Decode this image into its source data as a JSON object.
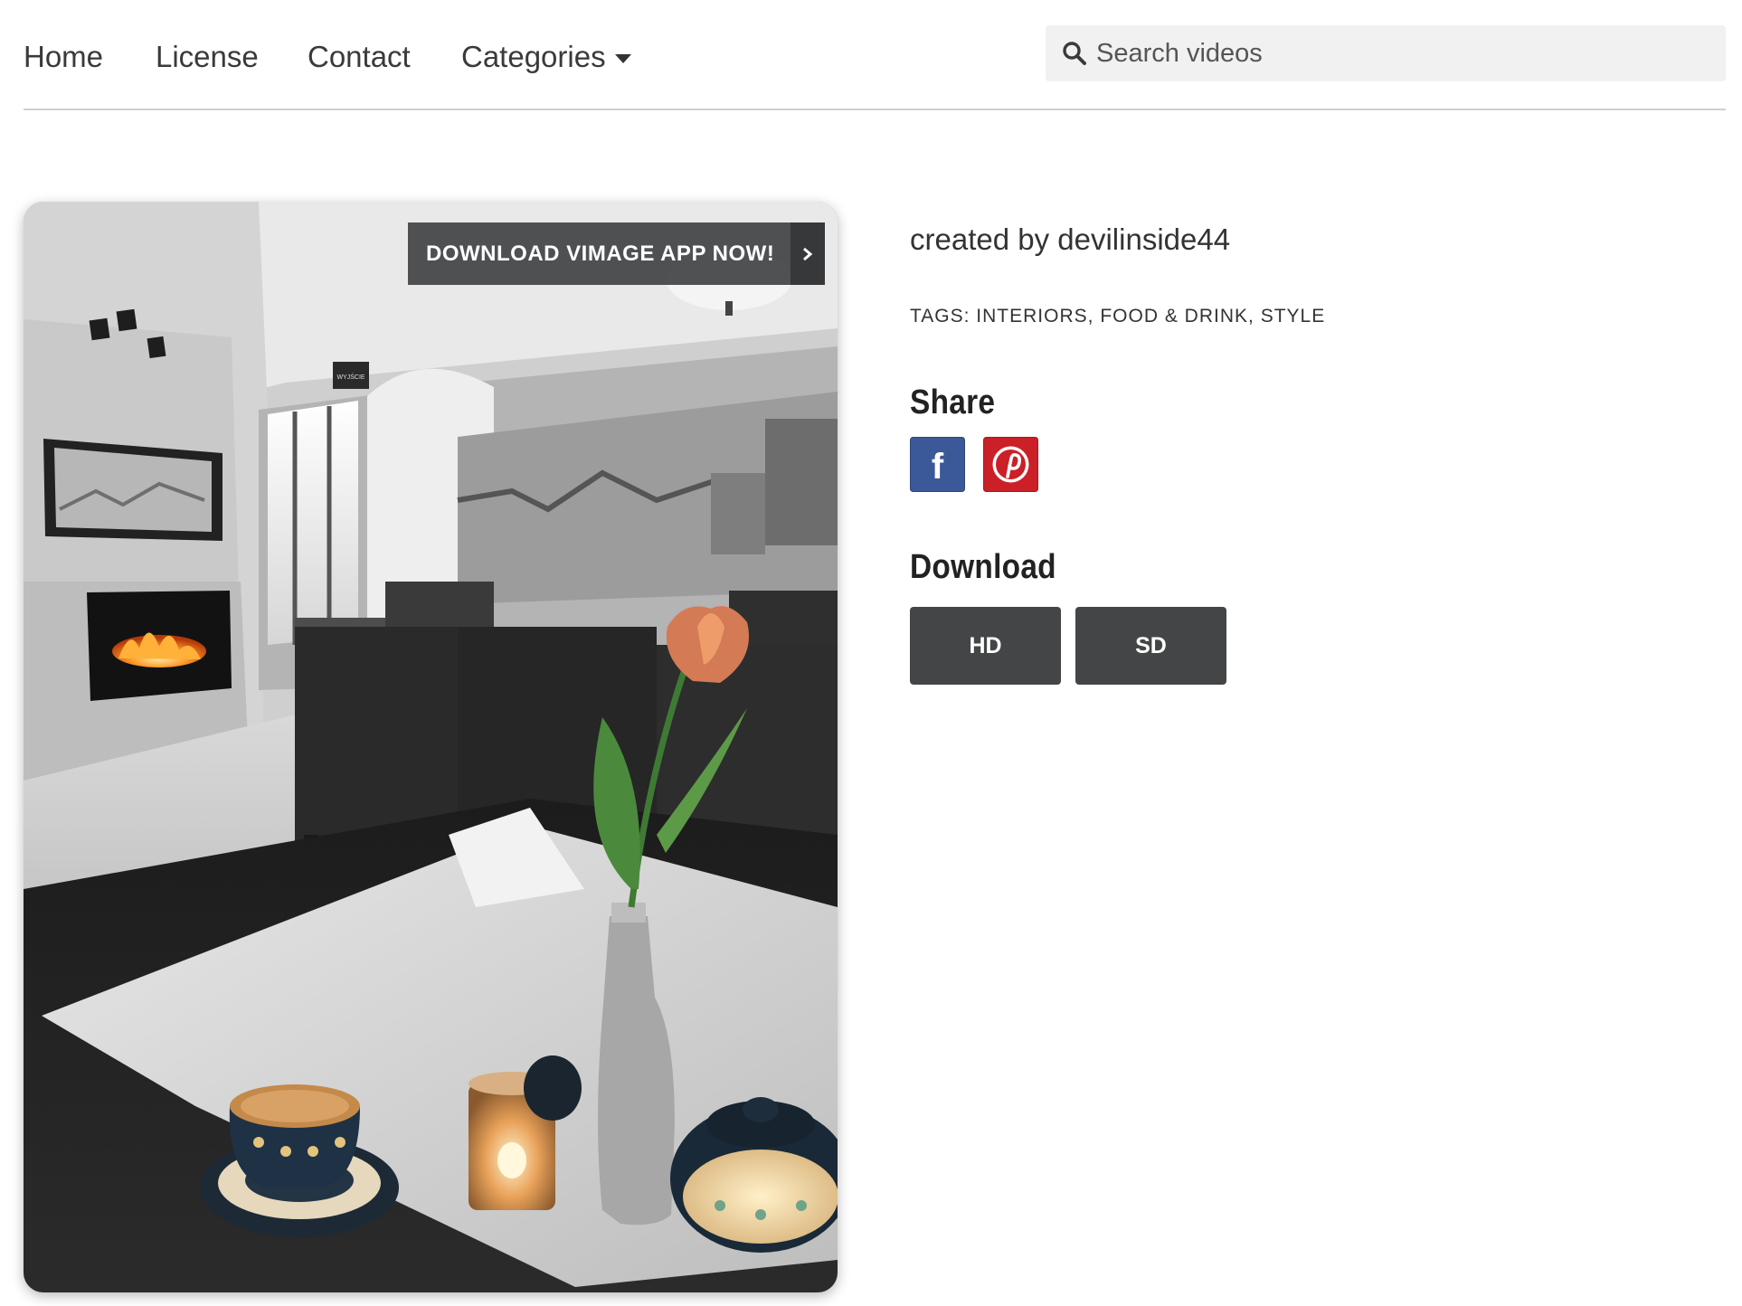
{
  "nav": {
    "home": "Home",
    "license": "License",
    "contact": "Contact",
    "categories": "Categories"
  },
  "search": {
    "placeholder": "Search videos",
    "value": ""
  },
  "promo": {
    "label": "DOWNLOAD VIMAGE APP NOW!"
  },
  "scene": {
    "sign_text": "WYJŚCIE"
  },
  "details": {
    "creator": "created by devilinside44",
    "tags_prefix": "TAGS:",
    "tags": [
      "INTERIORS",
      "FOOD & DRINK",
      "STYLE"
    ],
    "tag_separator": ","
  },
  "share": {
    "title": "Share",
    "facebook_letter": "f",
    "facebook_color": "#3b5998",
    "pinterest_color": "#cb2027"
  },
  "download": {
    "title": "Download",
    "hd_label": "HD",
    "sd_label": "SD"
  },
  "colors": {
    "button_bg": "#444546",
    "divider": "#cfcfcf",
    "search_bg": "#f1f1f1"
  }
}
